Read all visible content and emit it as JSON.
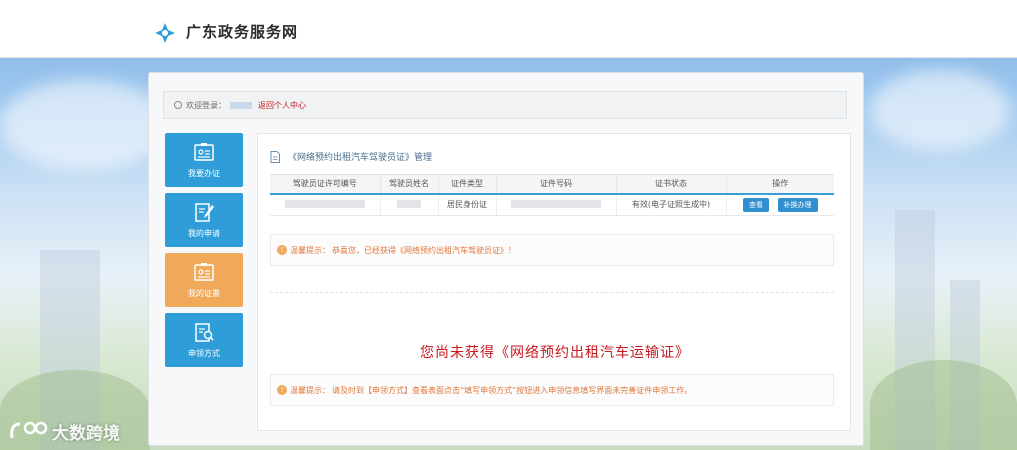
{
  "site": {
    "title": "广东政务服务网"
  },
  "welcome": {
    "label": "欢迎登录：",
    "return_link": "返回个人中心"
  },
  "sidebar": {
    "items": [
      {
        "label": "我要办证",
        "icon": "id-card-icon",
        "active": false
      },
      {
        "label": "我的申请",
        "icon": "edit-document-icon",
        "active": false
      },
      {
        "label": "我的证書",
        "icon": "id-card-icon",
        "active": true
      },
      {
        "label": "申领方式",
        "icon": "document-search-icon",
        "active": false
      }
    ]
  },
  "content": {
    "header": "《网络预约出租汽车驾驶员证》管理",
    "table": {
      "headers": [
        "驾驶员证许可编号",
        "驾驶员姓名",
        "证件类型",
        "证件号码",
        "证书状态",
        "操作"
      ],
      "rows": [
        {
          "cert_type": "居民身份证",
          "status": "有效(电子证照生成中)",
          "actions": [
            "查看",
            "补换办理"
          ]
        }
      ]
    },
    "tip1": {
      "label": "温馨提示：",
      "text": "恭喜您，已经获得《网络预约出租汽车驾驶员证》！"
    },
    "not_obtained": "您尚未获得《网络预约出租汽车运输证》",
    "tip2": {
      "label": "温馨提示：",
      "text": "请及时到【申领方式】查看表面点击“填写申领方式”按钮进入申领信息填写界面未完善证件申领工作。"
    }
  },
  "watermark": {
    "text": "大数跨境"
  },
  "colors": {
    "accent_blue": "#2f9ed8",
    "active_orange": "#f0a85b",
    "alert_red": "#c8161d"
  }
}
